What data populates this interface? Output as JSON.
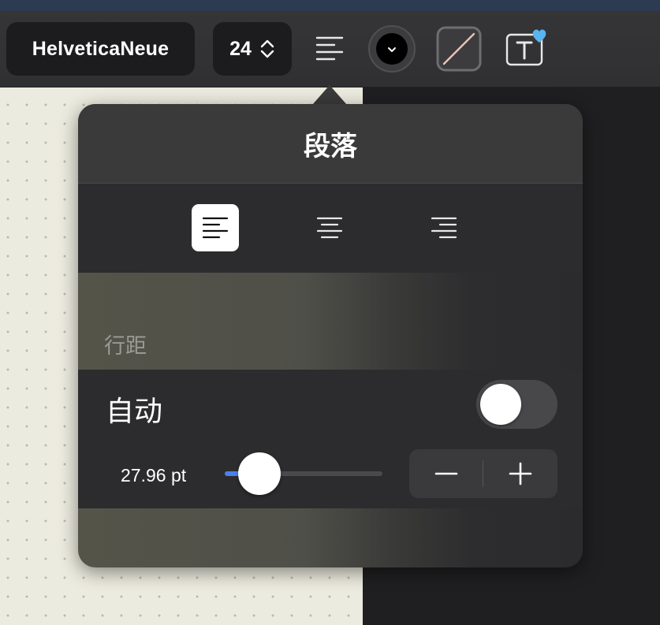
{
  "toolbar": {
    "font_name": "HelveticaNeue",
    "font_size": "24",
    "icons": [
      "paragraph-align-icon",
      "text-color-icon",
      "highlight-color-icon",
      "text-style-icon"
    ]
  },
  "popover": {
    "title": "段落",
    "alignment": {
      "options": [
        "left",
        "center",
        "right"
      ],
      "selected": "left"
    },
    "line_spacing": {
      "section_label": "行距",
      "auto_label": "自动",
      "auto_enabled": false,
      "value_text": "27.96 pt",
      "slider_fraction": 0.22
    }
  },
  "colors": {
    "accent": "#4a80f0",
    "heart": "#5ab4f0",
    "text_color": "#000000"
  }
}
